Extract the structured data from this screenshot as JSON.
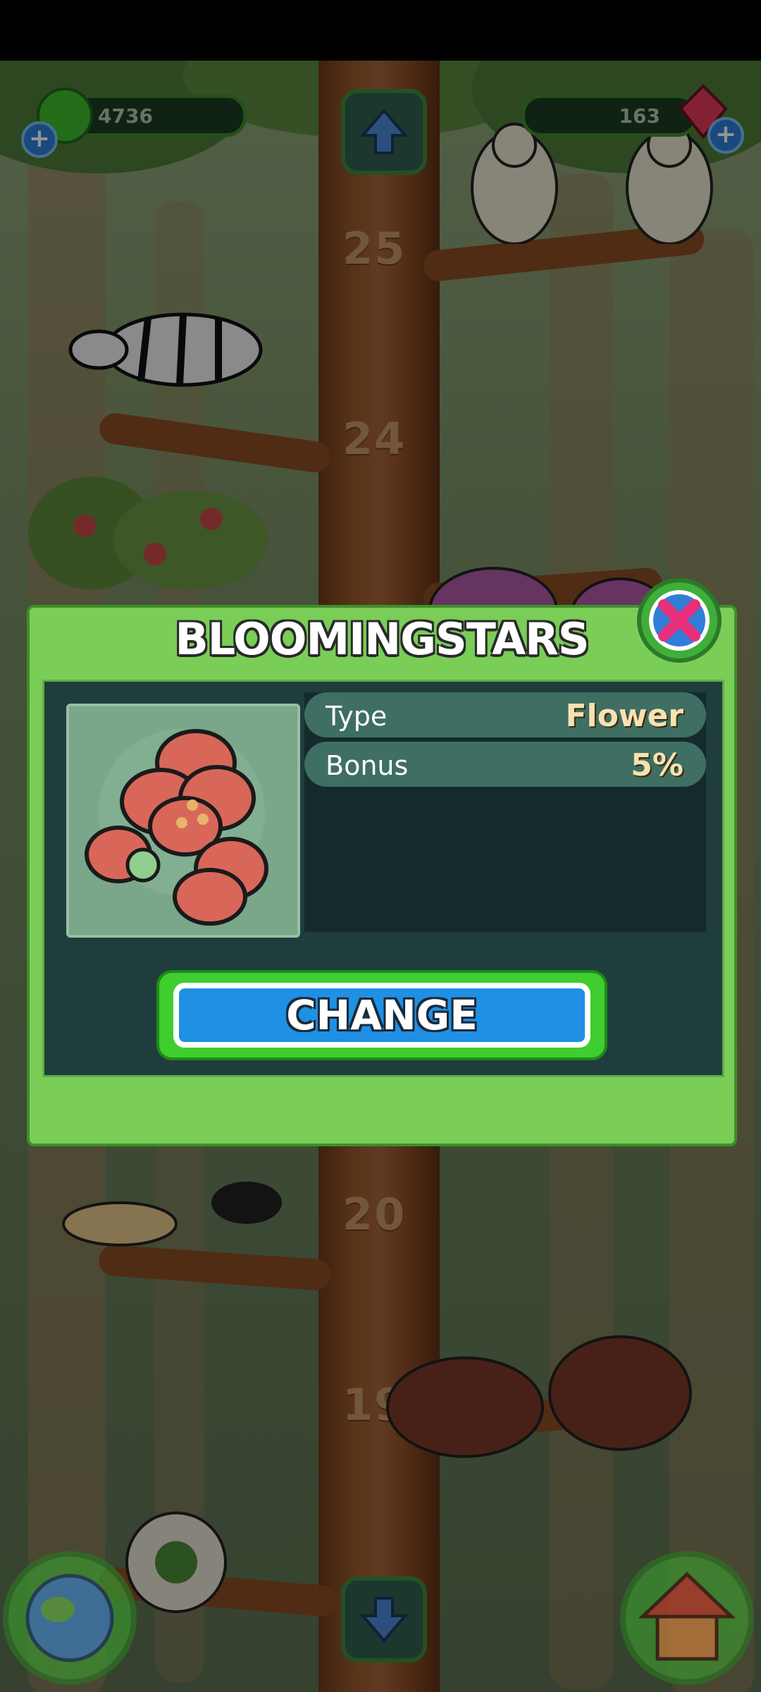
{
  "hud": {
    "left_currency_value": "4736",
    "right_currency_value": "163",
    "left_icon": "green-gem-icon",
    "right_icon": "red-crystal-icon"
  },
  "tree_levels": [
    "25",
    "24",
    "20",
    "19"
  ],
  "dialog": {
    "title": "BLOOMINGSTARS",
    "item_icon": "red-flower-icon",
    "stats": [
      {
        "label": "Type",
        "value": "Flower"
      },
      {
        "label": "Bonus",
        "value": "5%"
      }
    ],
    "change_button_label": "CHANGE"
  },
  "colors": {
    "dialog_green": "#7acd57",
    "dialog_body": "#1f3d3d",
    "stat_row": "#3f6e62",
    "button_blue": "#1f90e4",
    "close_pink": "#e8307a"
  }
}
